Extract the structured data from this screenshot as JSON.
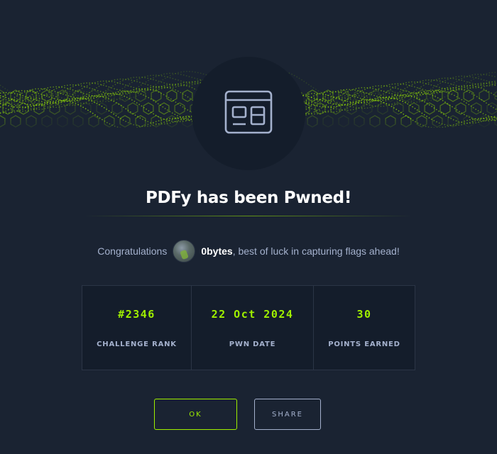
{
  "icon": "browser-window-icon",
  "title": "PDFy has been Pwned!",
  "message": {
    "prefix": "Congratulations",
    "username": "0bytes",
    "suffix": ", best of luck in capturing flags ahead!"
  },
  "stats": [
    {
      "value": "#2346",
      "label": "CHALLENGE RANK"
    },
    {
      "value": "22 Oct 2024",
      "label": "PWN DATE"
    },
    {
      "value": "30",
      "label": "POINTS EARNED"
    }
  ],
  "buttons": {
    "ok": "OK",
    "share": "SHARE"
  },
  "colors": {
    "background": "#1a2332",
    "accent": "#9fef00",
    "panel": "#141d2b",
    "muted": "#a4b1cd"
  }
}
